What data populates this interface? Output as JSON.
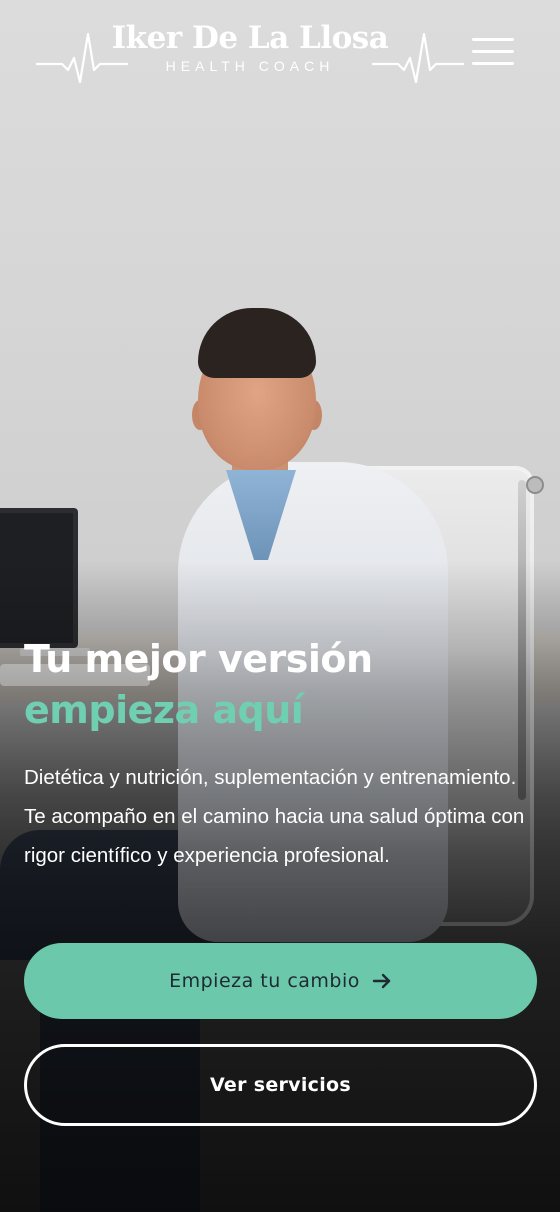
{
  "header": {
    "brand_name": "Iker De La Llosa",
    "brand_subtitle": "HEALTH COACH",
    "menu_icon": "hamburger-menu-icon"
  },
  "hero": {
    "headline_line1": "Tu mejor versión",
    "headline_line2": "empieza aquí",
    "description": "Dietética y nutrición, suplementación y entrenamiento. Te acompaño en el camino hacia una salud óptima con rigor científico y experiencia profesional.",
    "primary_button_label": "Empieza tu cambio",
    "primary_button_icon": "arrow-right-icon",
    "secondary_button_label": "Ver servicios"
  },
  "colors": {
    "accent": "#6fcfb0",
    "primary_button_bg": "#6cc8ab",
    "primary_button_text": "#1f2a33",
    "text_light": "#ffffff"
  }
}
